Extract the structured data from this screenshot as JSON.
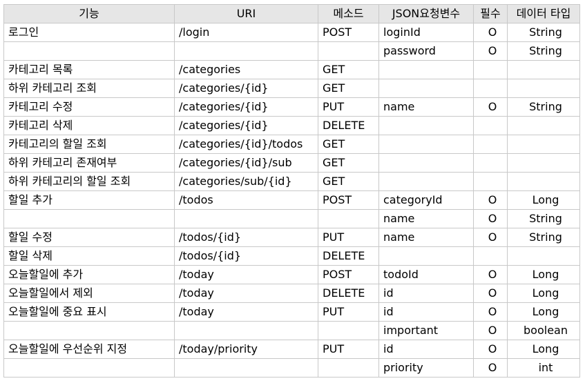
{
  "headers": {
    "function": "기능",
    "uri": "URI",
    "method": "메소드",
    "json_param": "JSON요청변수",
    "required": "필수",
    "data_type": "데이터 타입"
  },
  "rows": [
    {
      "function": "로그인",
      "uri": "/login",
      "method": "POST",
      "param": "loginId",
      "required": "O",
      "type": "String"
    },
    {
      "function": "",
      "uri": "",
      "method": "",
      "param": "password",
      "required": "O",
      "type": "String"
    },
    {
      "function": "카테고리 목록",
      "uri": "/categories",
      "method": "GET",
      "param": "",
      "required": "",
      "type": ""
    },
    {
      "function": "하위 카테고리 조회",
      "uri": "/categories/{id}",
      "method": "GET",
      "param": "",
      "required": "",
      "type": ""
    },
    {
      "function": "카테고리 수정",
      "uri": "/categories/{id}",
      "method": "PUT",
      "param": "name",
      "required": "O",
      "type": "String"
    },
    {
      "function": "카테고리 삭제",
      "uri": "/categories/{id}",
      "method": "DELETE",
      "param": "",
      "required": "",
      "type": ""
    },
    {
      "function": "카테고리의 할일 조회",
      "uri": "/categories/{id}/todos",
      "method": "GET",
      "param": "",
      "required": "",
      "type": ""
    },
    {
      "function": "하위 카테고리 존재여부",
      "uri": "/categories/{id}/sub",
      "method": "GET",
      "param": "",
      "required": "",
      "type": ""
    },
    {
      "function": "하위 카테고리의 할일 조회",
      "uri": "/categories/sub/{id}",
      "method": "GET",
      "param": "",
      "required": "",
      "type": ""
    },
    {
      "function": "할일 추가",
      "uri": "/todos",
      "method": "POST",
      "param": "categoryId",
      "required": "O",
      "type": "Long"
    },
    {
      "function": "",
      "uri": "",
      "method": "",
      "param": "name",
      "required": "O",
      "type": "String"
    },
    {
      "function": "할일 수정",
      "uri": "/todos/{id}",
      "method": "PUT",
      "param": "name",
      "required": "O",
      "type": "String"
    },
    {
      "function": "할일 삭제",
      "uri": "/todos/{id}",
      "method": "DELETE",
      "param": "",
      "required": "",
      "type": ""
    },
    {
      "function": "오늘할일에 추가",
      "uri": "/today",
      "method": "POST",
      "param": "todoId",
      "required": "O",
      "type": "Long"
    },
    {
      "function": "오늘할일에서 제외",
      "uri": "/today",
      "method": "DELETE",
      "param": "id",
      "required": "O",
      "type": "Long"
    },
    {
      "function": "오늘할일에 중요 표시",
      "uri": "/today",
      "method": "PUT",
      "param": "id",
      "required": "O",
      "type": "Long"
    },
    {
      "function": "",
      "uri": "",
      "method": "",
      "param": "important",
      "required": "O",
      "type": "boolean"
    },
    {
      "function": "오늘할일에 우선순위 지정",
      "uri": "/today/priority",
      "method": "PUT",
      "param": "id",
      "required": "O",
      "type": "Long"
    },
    {
      "function": "",
      "uri": "",
      "method": "",
      "param": "priority",
      "required": "O",
      "type": "int"
    }
  ]
}
